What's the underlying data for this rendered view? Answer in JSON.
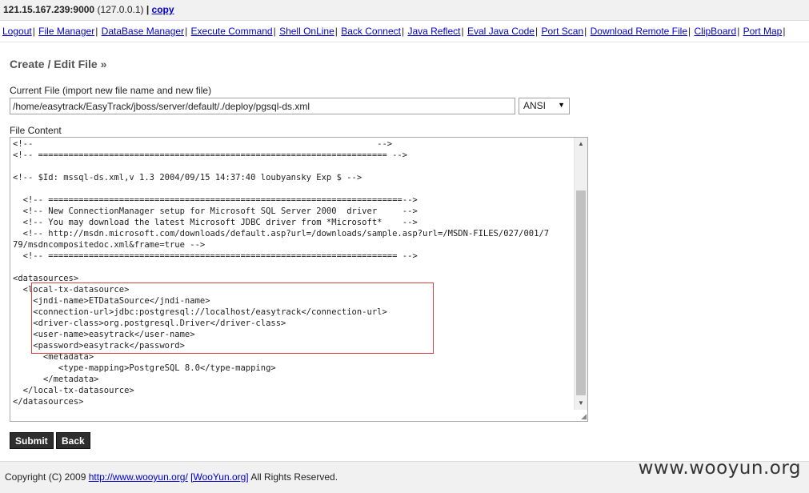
{
  "topbar": {
    "host": "121.15.167.239:9000",
    "local": "(127.0.0.1)",
    "separator": "|",
    "copy": "copy"
  },
  "nav": {
    "items": [
      "Logout",
      "File Manager",
      "DataBase Manager",
      "Execute Command",
      "Shell OnLine",
      "Back Connect",
      "Java Reflect",
      "Eval Java Code",
      "Port Scan",
      "Download Remote File",
      "ClipBoard",
      "Port Map"
    ],
    "separator": "|"
  },
  "page": {
    "title": "Create / Edit File »",
    "current_file_label": "Current File (import new file name and new file)",
    "current_file_value": "/home/easytrack/EasyTrack/jboss/server/default/./deploy/pgsql-ds.xml",
    "encoding": "ANSI",
    "file_content_label": "File Content",
    "file_content": "<!--                                                                    -->\n<!-- ===================================================================== -->\n\n<!-- $Id: mssql-ds.xml,v 1.3 2004/09/15 14:37:40 loubyansky Exp $ -->\n\n  <!-- ======================================================================-->\n  <!-- New ConnectionManager setup for Microsoft SQL Server 2000  driver     -->\n  <!-- You may download the latest Microsoft JDBC driver from *Microsoft*    -->\n  <!-- http://msdn.microsoft.com/downloads/default.asp?url=/downloads/sample.asp?url=/MSDN-FILES/027/001/7\n79/msdncompositedoc.xml&frame=true -->\n  <!-- ===================================================================== -->\n\n<datasources>\n  <local-tx-datasource>\n    <jndi-name>ETDataSource</jndi-name>\n    <connection-url>jdbc:postgresql://localhost/easytrack</connection-url>\n    <driver-class>org.postgresql.Driver</driver-class>\n    <user-name>easytrack</user-name>\n    <password>easytrack</password>\n      <metadata>\n         <type-mapping>PostgreSQL 8.0</type-mapping>\n      </metadata>\n  </local-tx-datasource>\n</datasources>",
    "submit_label": "Submit",
    "back_label": "Back"
  },
  "footer": {
    "copyright": "Copyright (C) 2009",
    "link1": "http://www.wooyun.org/",
    "link2": "[WooYun.org]",
    "rights": "All Rights Reserved."
  },
  "watermark": "www.wooyun.org"
}
